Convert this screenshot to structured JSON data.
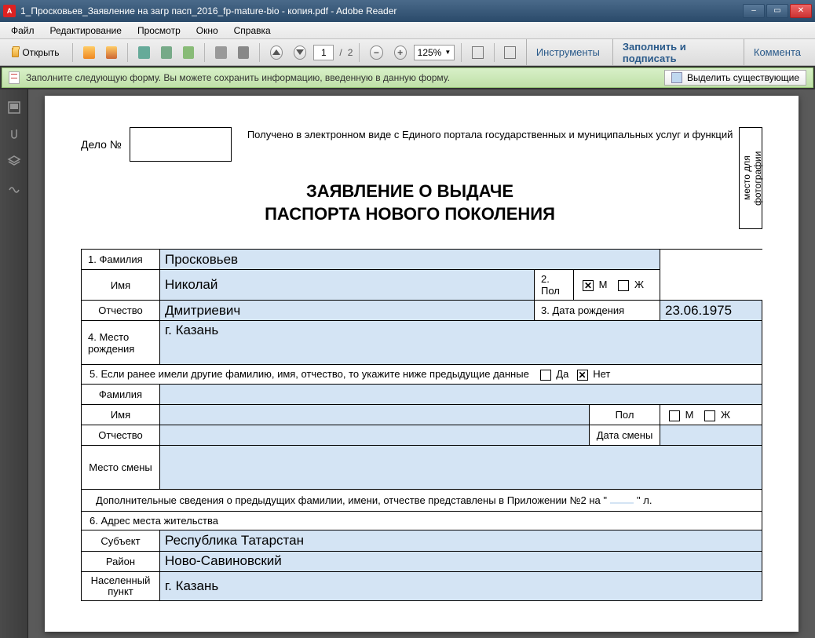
{
  "window": {
    "title": "1_Просковьев_Заявление на загр пасп_2016_fp-mature-bio - копия.pdf - Adobe Reader"
  },
  "menu": {
    "file": "Файл",
    "edit": "Редактирование",
    "view": "Просмотр",
    "window": "Окно",
    "help": "Справка"
  },
  "toolbar": {
    "open": "Открыть",
    "page_current": "1",
    "page_sep": "/",
    "page_total": "2",
    "zoom": "125%",
    "tools": "Инструменты",
    "fill_sign": "Заполнить и подписать",
    "comment": "Коммента"
  },
  "formbar": {
    "text": "Заполните следующую форму. Вы можете сохранить информацию, введенную в данную форму.",
    "highlight": "Выделить существующие"
  },
  "doc": {
    "delo_label": "Дело №",
    "portal": "Получено в электронном виде с Единого портала государственных и муниципальных услуг и функций",
    "photo_label": "место для фотографии",
    "title_1": "ЗАЯВЛЕНИЕ О ВЫДАЧЕ",
    "title_2": "ПАСПОРТА НОВОГО ПОКОЛЕНИЯ",
    "l_surname": "1. Фамилия",
    "v_surname": "Просковьев",
    "l_name": "Имя",
    "v_name": "Николай",
    "l_sex": "2. Пол",
    "sex_m": "М",
    "sex_f": "Ж",
    "l_patronymic": "Отчество",
    "v_patronymic": "Дмитриевич",
    "l_dob": "3. Дата рождения",
    "v_dob": "23.06.1975",
    "l_birthplace": "4. Место рождения",
    "v_birthplace": "г. Казань",
    "l_prev_q": "5. Если ранее имели другие фамилию, имя, отчество, то укажите ниже предыдущие данные",
    "yes": "Да",
    "no": "Нет",
    "l_prev_surname": "Фамилия",
    "l_prev_name": "Имя",
    "l_prev_sex": "Пол",
    "l_prev_patronymic": "Отчество",
    "l_change_date": "Дата смены",
    "l_change_place": "Место смены",
    "appendix_prefix": "Дополнительные сведения о предыдущих фамилии, имени, отчестве представлены в Приложении №2 на \"",
    "appendix_value": "",
    "appendix_suffix": "\" л.",
    "l_address_section": "6. Адрес места жительства",
    "l_subject": "Субъект",
    "v_subject": "Республика Татарстан",
    "l_district": "Район",
    "v_district": "Ново-Савиновский",
    "l_city": "Населенный пункт",
    "v_city": "г. Казань"
  }
}
